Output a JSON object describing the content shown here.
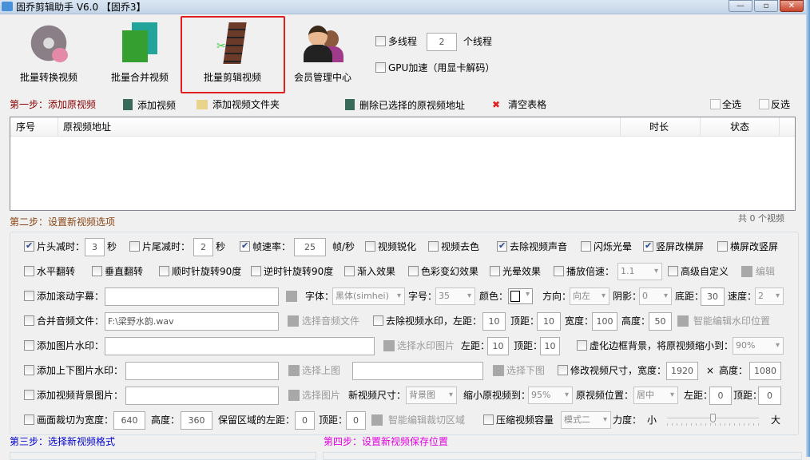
{
  "window": {
    "title": "固乔剪辑助手 V6.0  【固乔3】",
    "minimize": "—",
    "maximize": "▫",
    "close": "✕"
  },
  "toolbar": [
    {
      "label": "批量转换视频",
      "icon": "film-reel-icon"
    },
    {
      "label": "批量合并视频",
      "icon": "merge-film-icon"
    },
    {
      "label": "批量剪辑视频",
      "icon": "film-cut-icon",
      "selected": true
    },
    {
      "label": "会员管理中心",
      "icon": "users-icon"
    }
  ],
  "threads": {
    "multithread_label": "多线程",
    "value": "2",
    "unit": "个线程",
    "gpu_label": "GPU加速（用显卡解码）"
  },
  "step1": {
    "title": "第一步：添加原视频",
    "add_video": "添加视频",
    "add_folder": "添加视频文件夹",
    "delete_selected": "删除已选择的原视频地址",
    "clear_table": "清空表格",
    "select_all": "全选",
    "invert": "反选"
  },
  "table": {
    "columns": [
      "序号",
      "原视频地址",
      "时长",
      "状态"
    ],
    "rows": []
  },
  "step2": {
    "title": "第二步：设置新视频选项",
    "count": "共 0 个视频"
  },
  "opts": {
    "head_trim": "片头减时：",
    "head_val": "3",
    "sec": "秒",
    "tail_trim": "片尾减时：",
    "tail_val": "2",
    "fps": "帧速率：",
    "fps_val": "25",
    "fps_unit": "帧/秒",
    "sharpen": "视频锐化",
    "decolor": "视频去色",
    "mute": "去除视频声音",
    "flash": "闪烁光晕",
    "v2h": "竖屏改横屏",
    "h2v": "横屏改竖屏",
    "hflip": "水平翻转",
    "vflip": "垂直翻转",
    "cw90": "顺时针旋转90度",
    "ccw90": "逆时针旋转90度",
    "fadein": "渐入效果",
    "color_fx": "色彩变幻效果",
    "halo": "光晕效果",
    "speed_label": "播放倍速：",
    "speed_val": "1.1",
    "advanced": "高级自定义",
    "edit": "编辑",
    "scroll_sub": "添加滚动字幕：",
    "font": "字体：",
    "font_val": "黑体(simhei)",
    "size": "字号：",
    "size_val": "35",
    "color": "颜色：",
    "dir": "方向：",
    "dir_val": "向左",
    "shadow": "阴影：",
    "shadow_val": "0",
    "bottom": "底距：",
    "bottom_val": "30",
    "spd": "速度：",
    "spd_val": "2",
    "merge_audio": "合并音频文件：",
    "audio_path": "F:\\梁野水韵.wav",
    "pick_audio": "选择音频文件",
    "rm_wm": "去除视频水印，左距：",
    "wm_left": "10",
    "top": "顶距：",
    "wm_top": "10",
    "width": "宽度：",
    "wm_w": "100",
    "height": "高度：",
    "wm_h": "50",
    "smart_wm": "智能编辑水印位置",
    "img_wm": "添加图片水印：",
    "pick_wm": "选择水印图片",
    "left": "左距：",
    "iwm_left": "10",
    "iwm_top": "10",
    "blur": "虚化边框背景，将原视频缩小到：",
    "blur_val": "90%",
    "tb_wm": "添加上下图片水印：",
    "pick_top": "选择上图",
    "pick_bottom": "选择下图",
    "resize": "修改视频尺寸，宽度：",
    "rs_w": "1920",
    "times": "×",
    "rs_h": "1080",
    "bg_img": "添加视频背景图片：",
    "pick_img": "选择图片",
    "new_size": "新视频尺寸：",
    "new_size_val": "背景图",
    "shrink": "缩小原视频到：",
    "shrink_val": "95%",
    "pos": "原视频位置：",
    "pos_val": "居中",
    "bg_left": "0",
    "bg_top": "0",
    "crop": "画面裁切为宽度：",
    "crop_w": "640",
    "crop_h": "360",
    "keep_left": "保留区域的左距：",
    "crop_left": "0",
    "crop_top": "0",
    "smart_crop": "智能编辑裁切区域",
    "compress": "压缩视频容量",
    "mode_val": "模式二",
    "strength": "力度：",
    "small": "小",
    "big": "大",
    "strength_value": 0.5
  },
  "step3": {
    "title": "第三步：选择新视频格式"
  },
  "step4": {
    "title": "第四步：设置新视频保存位置"
  },
  "colors": {
    "step1": "#8b0000",
    "step2": "#8b4513",
    "step3": "#0000cc",
    "step4": "#e000e0",
    "highlight": "#e02020"
  }
}
